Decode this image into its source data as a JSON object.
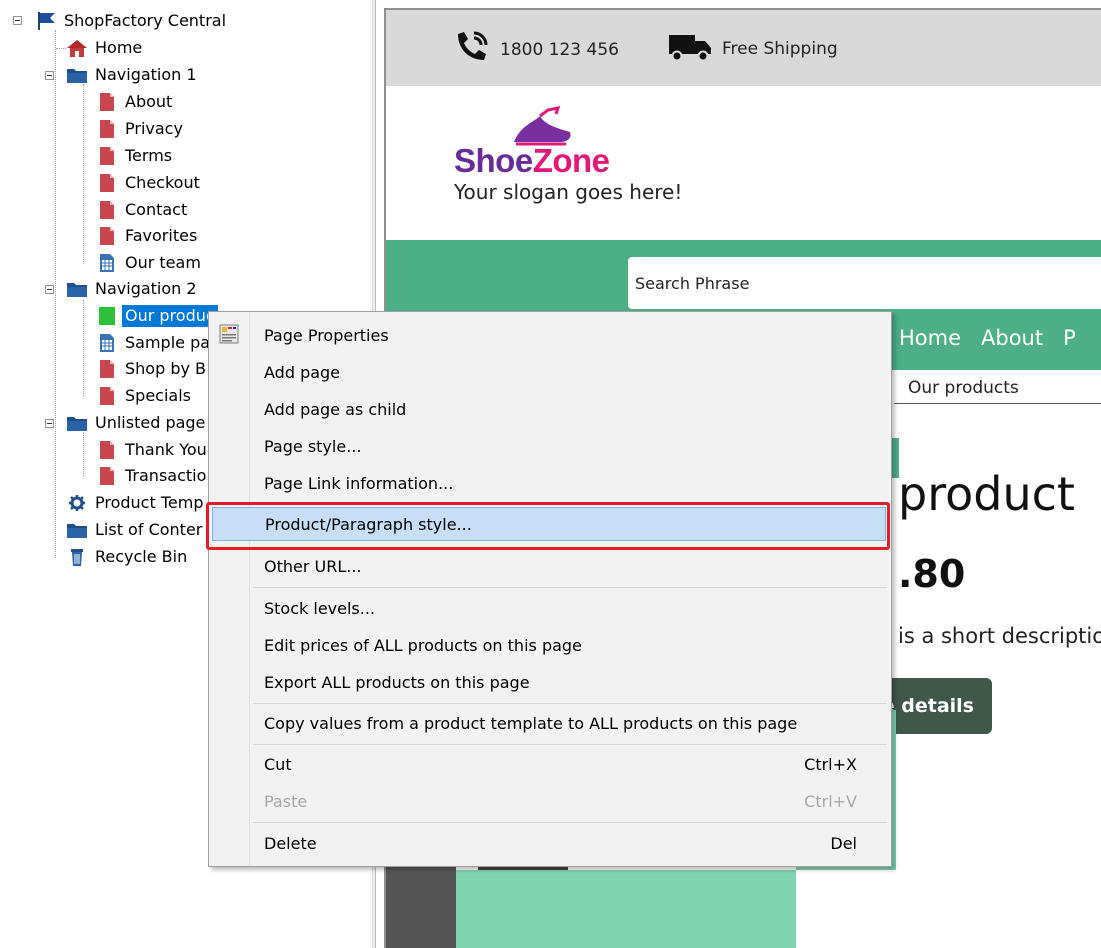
{
  "tree": {
    "root": "ShopFactory Central",
    "items": [
      {
        "label": "Home",
        "icon": "home-icon"
      },
      {
        "label": "Navigation 1",
        "icon": "folder-icon"
      },
      {
        "label": "About",
        "icon": "page-icon"
      },
      {
        "label": "Privacy",
        "icon": "page-icon"
      },
      {
        "label": "Terms",
        "icon": "page-icon"
      },
      {
        "label": "Checkout",
        "icon": "page-icon"
      },
      {
        "label": "Contact",
        "icon": "page-icon"
      },
      {
        "label": "Favorites",
        "icon": "page-icon"
      },
      {
        "label": "Our team",
        "icon": "grid-page-icon"
      },
      {
        "label": "Navigation 2",
        "icon": "folder-icon"
      },
      {
        "label": "Our produc",
        "icon": "green-square-icon"
      },
      {
        "label": "Sample pa",
        "icon": "grid-page-icon"
      },
      {
        "label": "Shop by B",
        "icon": "page-icon"
      },
      {
        "label": "Specials",
        "icon": "page-icon"
      },
      {
        "label": "Unlisted page",
        "icon": "folder-icon"
      },
      {
        "label": "Thank You",
        "icon": "page-icon"
      },
      {
        "label": "Transactio",
        "icon": "page-icon"
      },
      {
        "label": "Product Temp",
        "icon": "gear-icon"
      },
      {
        "label": "List of Conter",
        "icon": "folder-icon"
      },
      {
        "label": "Recycle Bin",
        "icon": "trash-icon"
      }
    ]
  },
  "preview": {
    "phone": "1800 123 456",
    "shipping": "Free Shipping",
    "brand_shoe": "Shoe",
    "brand_zone": "Zone",
    "slogan": "Your slogan goes here!",
    "search_placeholder": "Search Phrase",
    "menu": [
      "Home",
      "About",
      "P"
    ],
    "breadcrumb": "Our products",
    "product_title": "product",
    "product_price": ".80",
    "product_desc": "is a short descriptio",
    "details_button": "e details"
  },
  "context_menu": {
    "items": [
      {
        "label": "Page Properties",
        "shortcut": ""
      },
      {
        "label": "Add page",
        "shortcut": ""
      },
      {
        "label": "Add page as child",
        "shortcut": ""
      },
      {
        "label": "Page style...",
        "shortcut": ""
      },
      {
        "label": "Page Link information...",
        "shortcut": ""
      },
      {
        "label": "Product/Paragraph style...",
        "shortcut": ""
      },
      {
        "label": "Other URL...",
        "shortcut": ""
      },
      {
        "label": "Stock levels...",
        "shortcut": ""
      },
      {
        "label": "Edit prices of ALL products on this page",
        "shortcut": ""
      },
      {
        "label": "Export ALL products on this page",
        "shortcut": ""
      },
      {
        "label": "Copy values from a product template to ALL products on this page",
        "shortcut": ""
      },
      {
        "label": "Cut",
        "shortcut": "Ctrl+X"
      },
      {
        "label": "Paste",
        "shortcut": "Ctrl+V"
      },
      {
        "label": "Delete",
        "shortcut": "Del"
      }
    ]
  },
  "colors": {
    "selection": "#0078d7",
    "menu_highlight": "#c6dff6",
    "callout": "#e41e26",
    "site_green": "#4caf86"
  }
}
